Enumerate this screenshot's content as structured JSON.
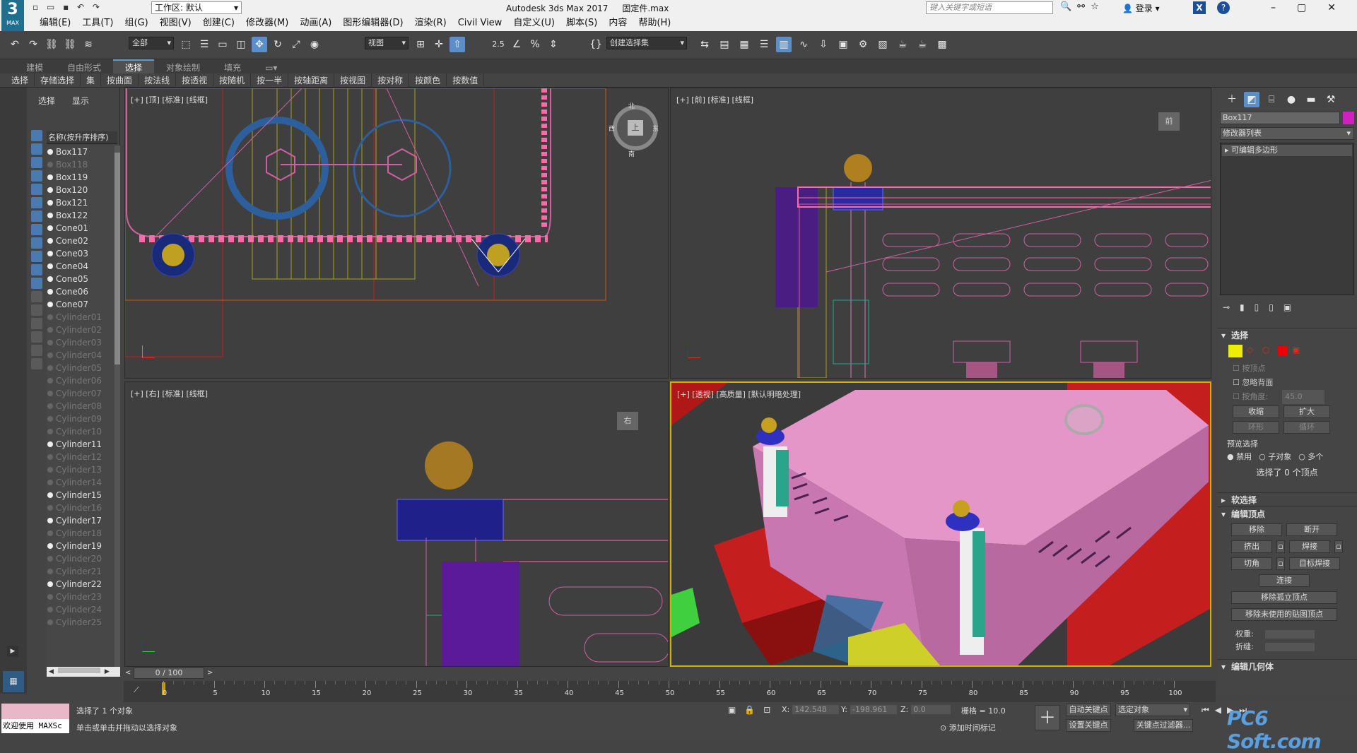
{
  "titlebar": {
    "app_title": "Autodesk 3ds Max 2017",
    "file": "固定件.max",
    "workspace": "工作区: 默认",
    "search_placeholder": "键入关键字或短语",
    "login": "登录",
    "logo_num": "3",
    "logo_text": "MAX"
  },
  "menu": [
    "编辑(E)",
    "工具(T)",
    "组(G)",
    "视图(V)",
    "创建(C)",
    "修改器(M)",
    "动画(A)",
    "图形编辑器(D)",
    "渲染(R)",
    "Civil View",
    "自定义(U)",
    "脚本(S)",
    "内容",
    "帮助(H)"
  ],
  "toolbar": {
    "filter": "全部",
    "view": "视图",
    "selset": "创建选择集",
    "snap_num": "2.5"
  },
  "ribbon": {
    "tabs": [
      "建模",
      "自由形式",
      "选择",
      "对象绘制",
      "填充"
    ],
    "active_tab": "选择",
    "buttons": [
      "选择",
      "存储选择",
      "集",
      "按曲面",
      "按法线",
      "按透视",
      "按随机",
      "按一半",
      "按轴距离",
      "按视图",
      "按对称",
      "按颜色",
      "按数值"
    ]
  },
  "scene_explorer": {
    "tab_select": "选择",
    "tab_display": "显示",
    "column": "名称(按升序排序)",
    "items": [
      {
        "name": "Box117",
        "visible": true
      },
      {
        "name": "Box118",
        "visible": false
      },
      {
        "name": "Box119",
        "visible": true
      },
      {
        "name": "Box120",
        "visible": true
      },
      {
        "name": "Box121",
        "visible": true
      },
      {
        "name": "Box122",
        "visible": true
      },
      {
        "name": "Cone01",
        "visible": true
      },
      {
        "name": "Cone02",
        "visible": true
      },
      {
        "name": "Cone03",
        "visible": true
      },
      {
        "name": "Cone04",
        "visible": true
      },
      {
        "name": "Cone05",
        "visible": true
      },
      {
        "name": "Cone06",
        "visible": true
      },
      {
        "name": "Cone07",
        "visible": true
      },
      {
        "name": "Cylinder01",
        "visible": false
      },
      {
        "name": "Cylinder02",
        "visible": false
      },
      {
        "name": "Cylinder03",
        "visible": false
      },
      {
        "name": "Cylinder04",
        "visible": false
      },
      {
        "name": "Cylinder05",
        "visible": false
      },
      {
        "name": "Cylinder06",
        "visible": false
      },
      {
        "name": "Cylinder07",
        "visible": false
      },
      {
        "name": "Cylinder08",
        "visible": false
      },
      {
        "name": "Cylinder09",
        "visible": false
      },
      {
        "name": "Cylinder10",
        "visible": false
      },
      {
        "name": "Cylinder11",
        "visible": true
      },
      {
        "name": "Cylinder12",
        "visible": false
      },
      {
        "name": "Cylinder13",
        "visible": false
      },
      {
        "name": "Cylinder14",
        "visible": false
      },
      {
        "name": "Cylinder15",
        "visible": true
      },
      {
        "name": "Cylinder16",
        "visible": false
      },
      {
        "name": "Cylinder17",
        "visible": true
      },
      {
        "name": "Cylinder18",
        "visible": false
      },
      {
        "name": "Cylinder19",
        "visible": true
      },
      {
        "name": "Cylinder20",
        "visible": false
      },
      {
        "name": "Cylinder21",
        "visible": false
      },
      {
        "name": "Cylinder22",
        "visible": true
      },
      {
        "name": "Cylinder23",
        "visible": false
      },
      {
        "name": "Cylinder24",
        "visible": false
      },
      {
        "name": "Cylinder25",
        "visible": false
      }
    ]
  },
  "viewports": {
    "top": "[+] [顶] [标准] [线框]",
    "front": "[+] [前] [标准] [线框]",
    "left": "[+] [右] [标准] [线框]",
    "persp": "[+] [透视] [高质量] [默认明暗处理]",
    "cube_top": "上",
    "cube_front": "前",
    "cube_right": "右",
    "cube_n": "北",
    "cube_s": "南",
    "cube_w": "西",
    "cube_e": "东"
  },
  "command_panel": {
    "object_name": "Box117",
    "object_color": "#d020c0",
    "modifier_list": "修改器列表",
    "stack_item": "可编辑多边形",
    "selection": {
      "title": "选择",
      "by_vertex": "按顶点",
      "ignore_backface": "忽略背面",
      "by_angle": "按角度:",
      "angle": "45.0",
      "shrink": "收缩",
      "grow": "扩大",
      "ring": "环形",
      "loop": "循环",
      "preview": "预览选择",
      "off": "禁用",
      "subobj": "子对象",
      "multi": "多个",
      "status": "选择了 0 个顶点"
    },
    "soft_sel": "软选择",
    "edit_vertices": {
      "title": "编辑顶点",
      "remove": "移除",
      "break": "断开",
      "extrude": "挤出",
      "weld": "焊接",
      "chamfer": "切角",
      "target_weld": "目标焊接",
      "connect": "连接",
      "remove_iso": "移除孤立顶点",
      "remove_unused": "移除未使用的贴图顶点",
      "weight": "权重:",
      "crease": "折缝:"
    },
    "edit_geom": "编辑几何体"
  },
  "time": {
    "slider": "0 / 100",
    "ticks": [
      "0",
      "5",
      "10",
      "15",
      "20",
      "25",
      "30",
      "35",
      "40",
      "45",
      "50",
      "55",
      "60",
      "65",
      "70",
      "75",
      "80",
      "85",
      "90",
      "95",
      "100"
    ]
  },
  "status": {
    "maxscript": "欢迎使用 MAXSc",
    "line1": "选择了 1 个对象",
    "line2": "单击或单击并拖动以选择对象",
    "x_label": "X:",
    "x": "142.548",
    "y_label": "Y:",
    "y": "-198.961",
    "z_label": "Z:",
    "z": "0.0",
    "grid": "栅格 = 10.0",
    "autokey": "自动关键点",
    "setkey": "设置关键点",
    "selected": "选定对象",
    "keyfilter": "关键点过滤器...",
    "addtime": "添加时间标记"
  },
  "watermark": "PC6 Soft.com"
}
